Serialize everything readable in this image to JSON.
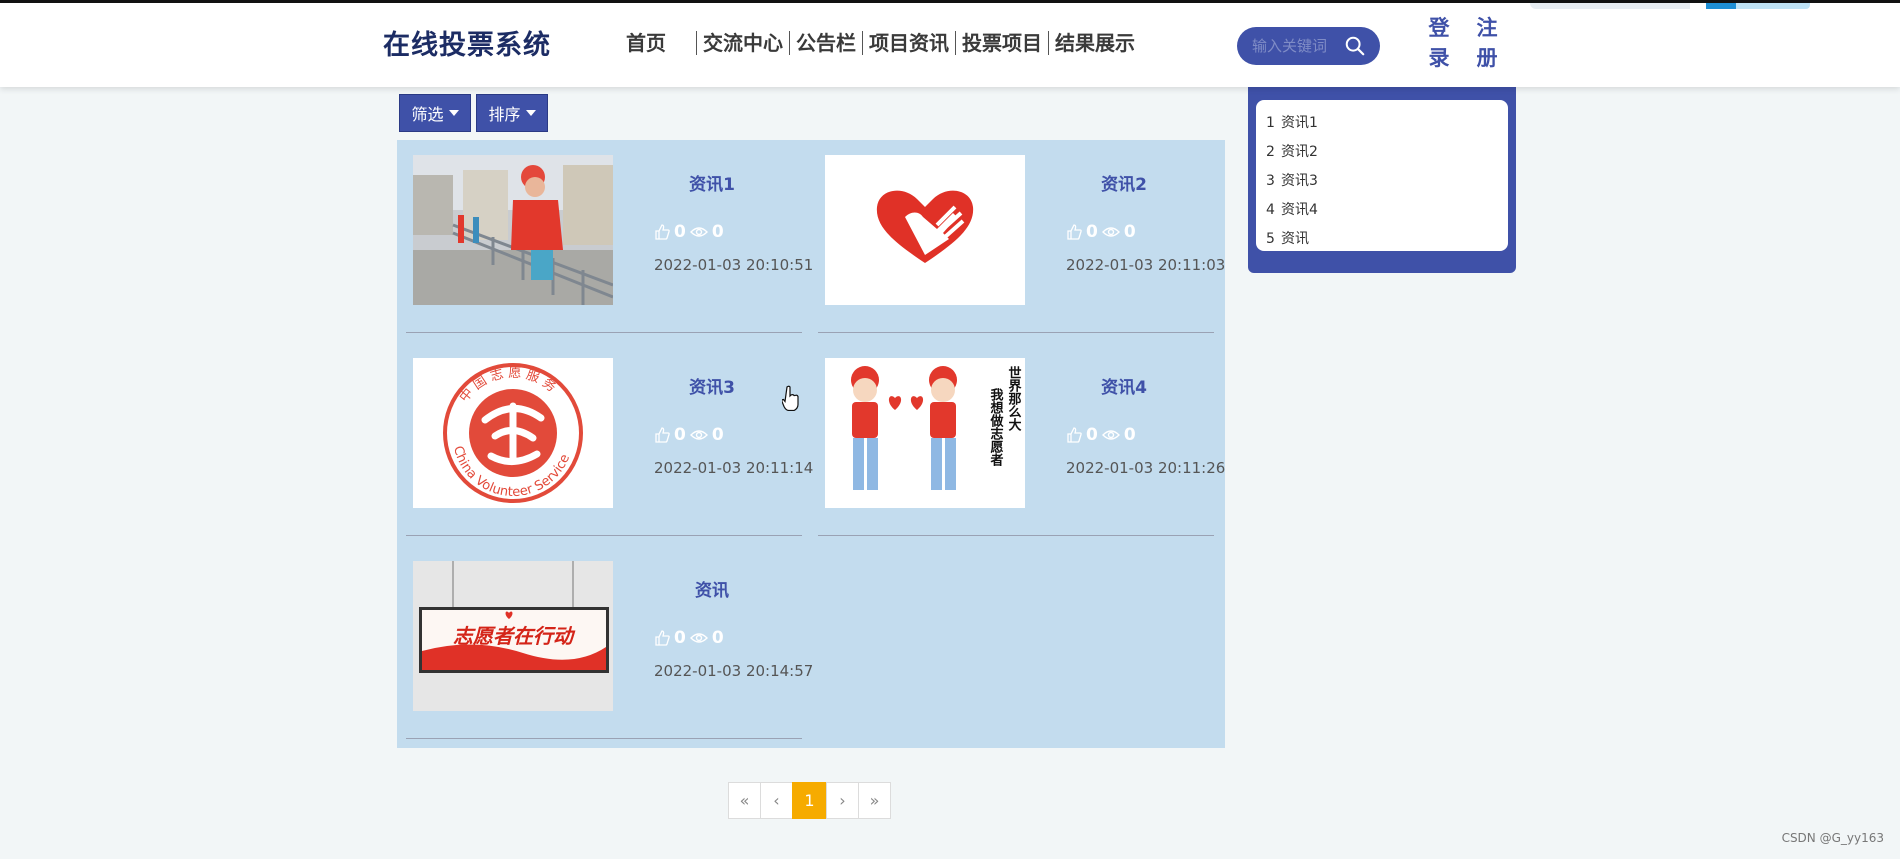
{
  "header": {
    "brand": "在线投票系统",
    "nav": [
      "首页",
      "交流中心",
      "公告栏",
      "项目资讯",
      "投票项目",
      "结果展示"
    ],
    "search_placeholder": "输入关键词",
    "login_label": "登录",
    "register_label": "注册"
  },
  "toolbar": {
    "filter_label": "筛选",
    "sort_label": "排序"
  },
  "news": [
    {
      "title": "资讯1",
      "likes": "0",
      "views": "0",
      "date": "2022-01-03 20:10:51",
      "image": "volunteer-cleaning-photo"
    },
    {
      "title": "资讯2",
      "likes": "0",
      "views": "0",
      "date": "2022-01-03 20:11:03",
      "image": "heart-hand-logo"
    },
    {
      "title": "资讯3",
      "likes": "0",
      "views": "0",
      "date": "2022-01-03 20:11:14",
      "image": "china-volunteer-service-logo"
    },
    {
      "title": "资讯4",
      "likes": "0",
      "views": "0",
      "date": "2022-01-03 20:11:26",
      "image": "volunteer-cartoon"
    },
    {
      "title": "资讯",
      "likes": "0",
      "views": "0",
      "date": "2022-01-03 20:14:57",
      "image": "volunteer-banner"
    }
  ],
  "image_text": {
    "cartoon_line1": "世界那么大",
    "cartoon_line2": "我想做志愿者",
    "banner_text": "志愿者在行动",
    "logo_ring": "中国志愿服务  China Volunteer Service"
  },
  "pagination": {
    "first": "«",
    "prev": "‹",
    "current": "1",
    "next": "›",
    "last": "»"
  },
  "sidebar": {
    "items": [
      {
        "num": "1",
        "label": "资讯1"
      },
      {
        "num": "2",
        "label": "资讯2"
      },
      {
        "num": "3",
        "label": "资讯3"
      },
      {
        "num": "4",
        "label": "资讯4"
      },
      {
        "num": "5",
        "label": "资讯"
      }
    ]
  },
  "watermark": "CSDN @G_yy163",
  "colors": {
    "accent": "#3f51a8",
    "panel": "#c3dcee",
    "page_active": "#f6ab00",
    "background": "#f2f6f7"
  }
}
